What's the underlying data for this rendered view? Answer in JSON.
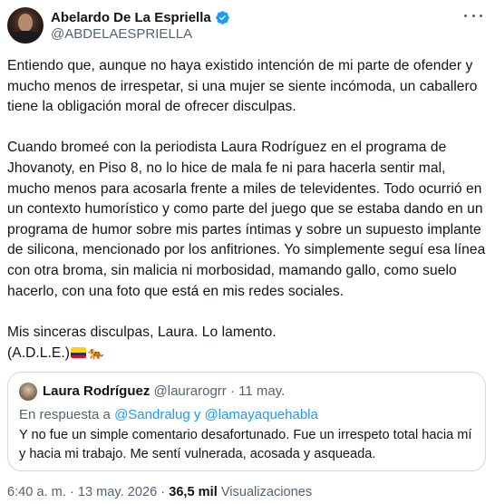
{
  "author": {
    "display_name": "Abelardo De La Espriella",
    "handle": "@ABDELAESPRIELLA",
    "verified_color": "#1d9bf0"
  },
  "tweet": {
    "paragraph_1": "Entiendo que, aunque no haya existido intención de mi parte de ofender y mucho menos de irrespetar, si una mujer se siente incómoda, un caballero tiene la obligación moral de ofrecer disculpas.",
    "paragraph_2": "Cuando bromeé con la periodista Laura Rodríguez en el programa de Jhovanoty, en Piso 8, no lo hice de mala fe ni para hacerla sentir mal, mucho menos para acosarla frente a miles de televidentes. Todo ocurrió en un contexto humorístico y como parte del juego que se estaba dando en un programa de humor sobre mis partes íntimas y sobre un supuesto implante de silicona, mencionado por los anfitriones. Yo simplemente seguí esa línea con otra broma, sin malicia ni morbosidad, mamando gallo, como suelo hacerlo, con una foto que está en mis redes sociales.",
    "paragraph_3": "Mis sinceras disculpas, Laura. Lo lamento.",
    "signature": "(A.D.L.E.)",
    "emoji_icons": [
      "colombia-flag-icon",
      "tiger-icon"
    ]
  },
  "quoted_tweet": {
    "display_name": "Laura Rodríguez",
    "meta": "@laurarogrr · 11 may.",
    "reply_prefix": "En respuesta a",
    "reply_mentions": "@Sandralug y @lamayaquehabla",
    "text": "Y no fue un simple comentario desafortunado. Fue un irrespeto total hacia mí y hacia mi trabajo. Me sentí vulnerada, acosada y asqueada."
  },
  "footer": {
    "timestamp": "6:40 a. m. · 13 may. 2026 ·",
    "views_count": "36,5 mil",
    "views_label": "Visualizaciones"
  }
}
